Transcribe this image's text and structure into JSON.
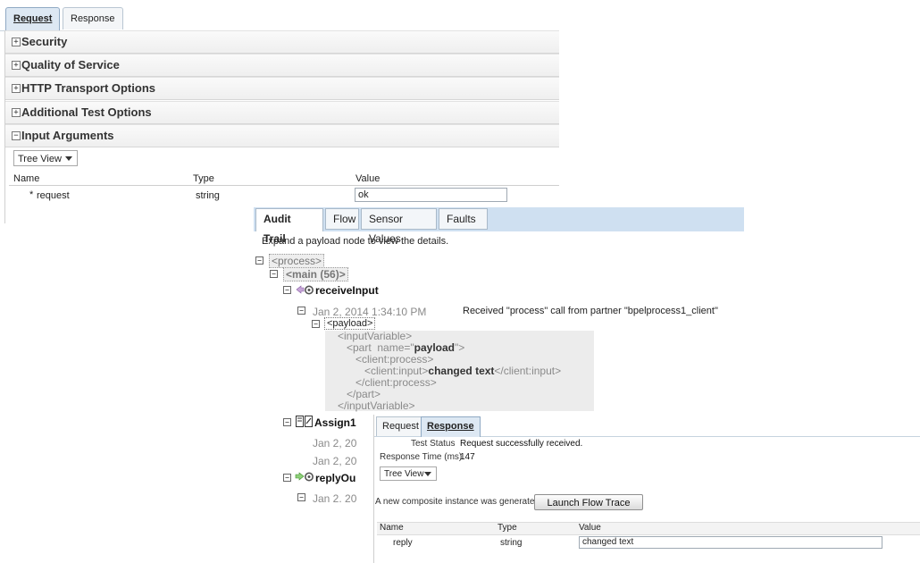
{
  "request_panel": {
    "tabs": [
      {
        "label": "Request",
        "active": true
      },
      {
        "label": "Response",
        "active": false
      }
    ],
    "sections": [
      {
        "label": "Security",
        "expanded": false
      },
      {
        "label": "Quality of Service",
        "expanded": false
      },
      {
        "label": "HTTP Transport Options",
        "expanded": false
      },
      {
        "label": "Additional Test Options",
        "expanded": false
      },
      {
        "label": "Input Arguments",
        "expanded": true
      }
    ],
    "view_select": "Tree View",
    "columns": {
      "name": "Name",
      "type": "Type",
      "value": "Value"
    },
    "row": {
      "required_mark": "*",
      "name": "request",
      "type": "string",
      "value": "ok"
    }
  },
  "audit_panel": {
    "tabs": [
      {
        "label": "Audit Trail",
        "active": true
      },
      {
        "label": "Flow",
        "active": false
      },
      {
        "label": "Sensor Values",
        "active": false
      },
      {
        "label": "Faults",
        "active": false
      }
    ],
    "hint": "Expand a payload node to view the details.",
    "tree": {
      "process": "<process>",
      "main": "<main (56)>",
      "receive": {
        "name": "receiveInput",
        "date": "Jan 2, 2014 1:34:10 PM",
        "message": "Received \"process\" call from partner \"bpelprocess1_client\"",
        "payload": "<payload>",
        "xml": {
          "l1": "<inputVariable>",
          "l2_open": "<part  name=\"",
          "l2_name": "payload",
          "l2_close": "\">",
          "l3": "<client:process>",
          "l4_open": "<client:input>",
          "l4_value": "changed text",
          "l4_close": "</client:input>",
          "l5": "</client:process>",
          "l6": "</part>",
          "l7": "</inputVariable>"
        }
      },
      "assign": {
        "name": "Assign1",
        "date1": "Jan 2, 20",
        "date2": "Jan 2, 20"
      },
      "reply": {
        "name": "replyOu",
        "date": "Jan 2. 20"
      }
    }
  },
  "response_panel": {
    "tabs": [
      {
        "label": "Request",
        "active": false
      },
      {
        "label": "Response",
        "active": true
      }
    ],
    "test_status_label": "Test Status",
    "test_status_value": "Request successfully received.",
    "response_time_label": "Response Time (ms)",
    "response_time_value": "147",
    "view_select": "Tree View",
    "composite_msg": "A new composite instance was generated.",
    "launch_button": "Launch Flow Trace",
    "columns": {
      "name": "Name",
      "type": "Type",
      "value": "Value"
    },
    "row": {
      "name": "reply",
      "type": "string",
      "value": "changed text"
    }
  }
}
